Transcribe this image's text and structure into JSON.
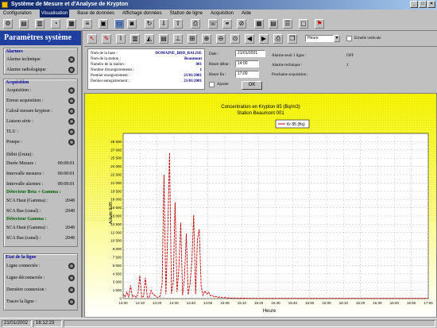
{
  "window": {
    "title": "Système de Mesure et d'Analyse de Krypton"
  },
  "menu": [
    "Configuration",
    "Visualisation",
    "Base de données",
    "Affichage données",
    "Station de ligne",
    "Acquisition",
    "Aide"
  ],
  "sidebar": {
    "title": "Paramètres système",
    "alarms": {
      "title": "Alarmes",
      "items": [
        {
          "label": "Alarme technique"
        },
        {
          "label": "Alarme radiologique"
        }
      ]
    },
    "acquisition": {
      "title": "Acquisition",
      "items": [
        {
          "label": "Acquisition :"
        },
        {
          "label": "Erreur acquisition :"
        },
        {
          "label": "Calcul mesure krypton :"
        },
        {
          "label": "Liaison série :"
        },
        {
          "label": "TLU :"
        },
        {
          "label": "Pompe :"
        }
      ],
      "params_title": "Débit (l/min) :",
      "params": [
        {
          "label": "Durée Mesure :",
          "value": "00:00:01"
        },
        {
          "label": "Intervalle mesures :",
          "value": "00:00:01"
        },
        {
          "label": "Intervalle alarmes :",
          "value": "00:00:01"
        }
      ],
      "beta_title": "Détecteur Beta + Gamma :",
      "beta": [
        {
          "label": "SCA Haut (Gamma) :",
          "value": "2048"
        },
        {
          "label": "SCA Bas (canal) :",
          "value": "2048"
        }
      ],
      "gamma_title": "Détecteur Gamma :",
      "gamma": [
        {
          "label": "SCA Haut (Gamma) :",
          "value": "2048"
        },
        {
          "label": "SCA Bas (canal) :",
          "value": "2048"
        }
      ]
    },
    "line": {
      "title": "Etat de la ligne",
      "items": [
        {
          "label": "Ligne connectée :"
        },
        {
          "label": "Ligne déconnectée :"
        },
        {
          "label": "Dernière connexion :"
        },
        {
          "label": "Tracer la ligne :"
        }
      ]
    }
  },
  "toolbar2": {
    "period": "Heure",
    "checkbox_label": "Echelle verticale"
  },
  "info": {
    "rows": [
      {
        "label": "Nom de la base :",
        "value": "DOMAINE_BDD_BALISE"
      },
      {
        "label": "Nom de la station :",
        "value": "Beaumont"
      },
      {
        "label": "Numéro de la station :",
        "value": "001"
      },
      {
        "label": "Nombre d'enregistrements :",
        "value": "1"
      },
      {
        "label": "Premier enregistrement :",
        "value": "21/01/2001"
      },
      {
        "label": "Dernier enregistrement :",
        "value": "21/01/2001"
      }
    ]
  },
  "filters": {
    "date_label": "Date :",
    "date_value": "21/01/2001",
    "start_label": "Heure début :",
    "start_value": "14:00",
    "end_label": "Heure fin :",
    "end_value": "17:00",
    "ok": "OK",
    "apply_label": "Ajuster"
  },
  "alarms_right": [
    {
      "label": "Alarme seuil 1 ligne :",
      "value": "OFF"
    },
    {
      "label": "Alarme technique :",
      "value": "1"
    },
    {
      "label": "Prochaine acquisition :",
      "value": ""
    }
  ],
  "chart_data": {
    "type": "line",
    "title": "Concentration en Krypton 85 (Bq/m3)",
    "subtitle": "Station Beaumont 001",
    "legend": "Kr 85 (Bq)",
    "xlabel": "Heure",
    "ylabel": "Activité Kr85",
    "ylim": [
      0,
      30000
    ],
    "yticks": [
      "0",
      "1 500",
      "3 000",
      "4 500",
      "6 000",
      "7 500",
      "9 000",
      "10 500",
      "12 000",
      "13 500",
      "15 000",
      "16 500",
      "18 000",
      "19 500",
      "21 000",
      "22 500",
      "24 000",
      "25 500",
      "27 000",
      "28 500"
    ],
    "xticks": [
      "14:00",
      "14:10",
      "14:20",
      "14:30",
      "14:40",
      "14:50",
      "15:00",
      "15:10",
      "15:20",
      "15:30",
      "15:40",
      "15:50",
      "16:00",
      "16:10",
      "16:20",
      "16:30",
      "16:40",
      "16:50",
      "17:00"
    ],
    "series": [
      {
        "name": "Kr 85",
        "color": "#c00000",
        "values": [
          800,
          300,
          1200,
          200,
          2400,
          300,
          600,
          200,
          900,
          4200,
          200,
          400,
          3800,
          300,
          200,
          1500,
          800,
          600,
          300,
          200,
          500,
          2800,
          22500,
          800,
          12000,
          26500,
          900,
          3200,
          17500,
          1200,
          5400,
          13800,
          600,
          3600,
          11800,
          700,
          2600,
          6800,
          15200,
          800,
          10800,
          12600,
          2200,
          600,
          1400,
          800,
          1200,
          500,
          600,
          300,
          400,
          200,
          300,
          200,
          150,
          200,
          100,
          150,
          100,
          120,
          100,
          80,
          100,
          80,
          60,
          80,
          60,
          50,
          60,
          50
        ]
      }
    ],
    "colors": {
      "background_top": "#f4f400",
      "plot_bg": "#ffffff",
      "line": "#c00000"
    }
  },
  "status": {
    "date": "21/01/2002",
    "time": "16:12:23"
  }
}
